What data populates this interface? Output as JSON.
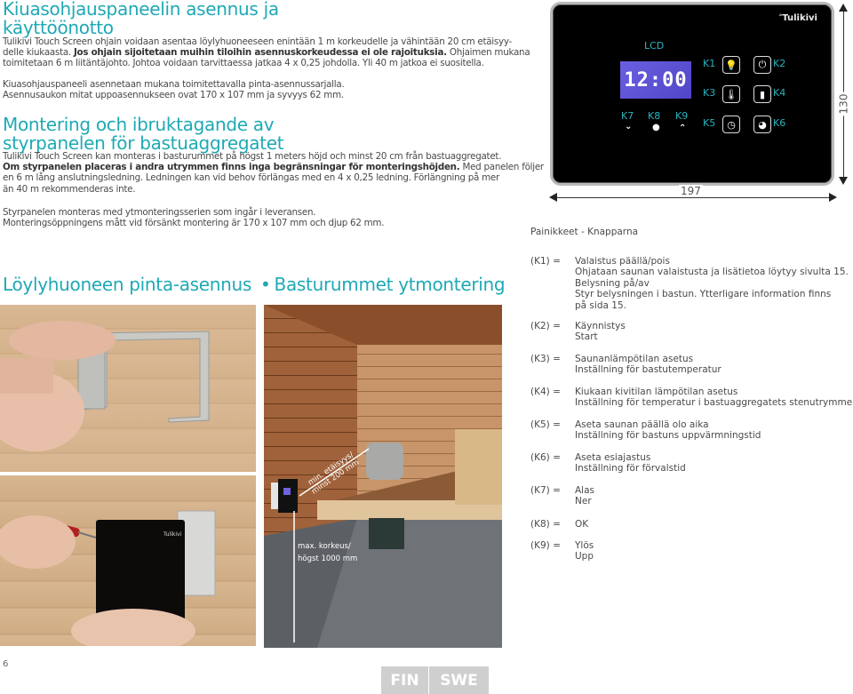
{
  "fi_section": {
    "title_line1": "Kiuasohjauspaneelin asennus ja",
    "title_line2": "käyttöönotto",
    "para1_lines": [
      {
        "normal": "Tulikivi Touch Screen ohjain voidaan asentaa löylyhuoneeseen enintään 1 m korkeudelle ja vähintään 20 cm etäisyy-"
      },
      {
        "normal": "delle kiukaasta. ",
        "bold": "Jos ohjain sijoitetaan muihin tiloihin asennuskorkeudessa ei ole rajoituksia.",
        "tail": " Ohjaimen mukana"
      },
      {
        "normal": "toimitetaan 6 m liitäntäjohto. Johtoa voidaan tarvittaessa jatkaa 4 x 0,25 johdolla. Yli 40 m jatkoa ei suositella."
      }
    ],
    "para2_lines": [
      "Kiuasohjauspaneeli asennetaan mukana toimitettavalla pinta-asennussarjalla.",
      "Asennusaukon mitat uppoasennukseen ovat 170 x 107 mm ja syvyys 62 mm."
    ]
  },
  "sv_section": {
    "title_line1": "Montering och ibruktagande av",
    "title_line2": "styrpanelen för bastuaggregatet",
    "para1_lines": [
      {
        "normal": "Tulikivi Touch Screen kan monteras i basturummet på högst 1 meters höjd och minst 20 cm från bastuaggregatet."
      },
      {
        "bold": "Om styrpanelen placeras i andra utrymmen finns inga begränsningar för monteringshöjden.",
        "tail": " Med panelen följer"
      },
      {
        "normal": "en 6 m lång anslutningsledning. Ledningen kan vid behov förlängas med en 4 x 0,25 ledning. Förlängning på mer"
      },
      {
        "normal": "än 40 m rekommenderas inte."
      }
    ],
    "para2_lines": [
      "Styrpanelen monteras med ytmonteringsserien som ingår i leveransen.",
      "Monteringsöppningens mått vid försänkt montering är 170 x 107 mm och djup 62 mm."
    ]
  },
  "panel": {
    "brand": "Tulikivi",
    "lcd_label": "LCD",
    "lcd_time": "12:00",
    "keys": {
      "k1": "K1",
      "k2": "K2",
      "k3": "K3",
      "k4": "K4",
      "k5": "K5",
      "k6": "K6",
      "k7": "K7",
      "k8": "K8",
      "k9": "K9"
    },
    "icons": {
      "k1": "light-bulb-icon",
      "k2": "power-icon",
      "k3": "thermometer-icon",
      "k4": "stone-temperature-icon",
      "k5": "clock-icon",
      "k6": "preset-timer-icon",
      "k7": "chevron-down-icon",
      "k8": "ok-dot-icon",
      "k9": "chevron-up-icon"
    },
    "width_label": "197",
    "height_label": "130",
    "caption": "Painikkeet - Knapparna"
  },
  "legend": [
    {
      "key": "(K1) =",
      "lines": [
        "Valaistus päällä/pois",
        "Ohjataan saunan valaistusta ja lisätietoa löytyy sivulta 15.",
        "Belysning på/av",
        "Styr belysningen i bastun. Ytterligare information finns",
        "på sida 15."
      ]
    },
    {
      "key": "(K2) =",
      "lines": [
        "Käynnistys",
        "Start"
      ]
    },
    {
      "key": "(K3) =",
      "lines": [
        "Saunanlämpötilan asetus",
        "Inställning för bastutemperatur"
      ]
    },
    {
      "key": "(K4) =",
      "lines": [
        "Kiukaan kivitilan lämpötilan asetus",
        "Inställning för temperatur i bastuaggregatets stenutrymme"
      ]
    },
    {
      "key": "(K5) =",
      "lines": [
        "Aseta saunan päällä olo aika",
        "Inställning för bastuns uppvärmningstid"
      ]
    },
    {
      "key": "(K6) =",
      "lines": [
        "Aseta esiajastus",
        "Inställning för förvalstid"
      ]
    },
    {
      "key": "(K7) =",
      "lines": [
        "Alas",
        "Ner"
      ]
    },
    {
      "key": "(K8) =",
      "lines": [
        "OK"
      ]
    },
    {
      "key": "(K9) =",
      "lines": [
        "Ylös",
        "Upp"
      ]
    }
  ],
  "mounting": {
    "title_fi": "Löylyhuoneen pinta-asennus",
    "separator": "•",
    "title_sv": "Basturummet ytmontering",
    "photo_panel_brand": "Tulikivi",
    "annotation_distance": [
      "min. etäisyys/",
      "minst 200 mm"
    ],
    "annotation_height": [
      "max. korkeus/",
      "högst 1000 mm"
    ]
  },
  "footer": {
    "page_number": "6",
    "lang_fin": "FIN",
    "lang_swe": "SWE"
  }
}
